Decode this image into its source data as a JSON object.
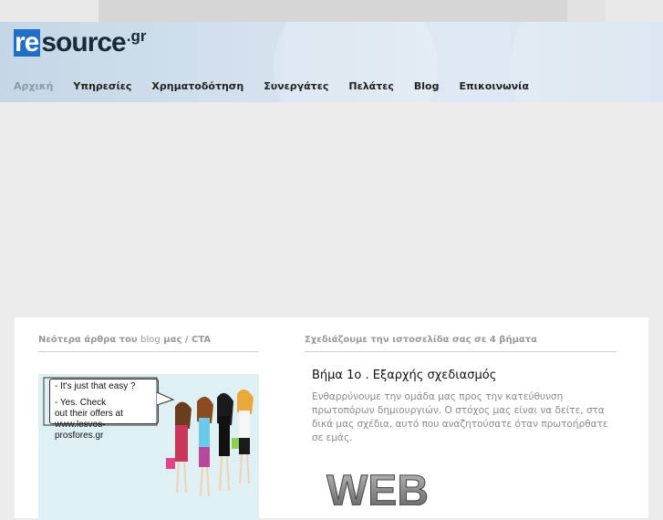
{
  "logo": {
    "prefix": "re",
    "rest": "source",
    "tld": ".gr"
  },
  "nav": {
    "items": [
      {
        "label": "Αρχική"
      },
      {
        "label": "Υπηρεσίες"
      },
      {
        "label": "Χρηματοδότηση"
      },
      {
        "label": "Συνεργάτες"
      },
      {
        "label": "Πελάτες"
      },
      {
        "label": "Blog"
      },
      {
        "label": "Επικοινωνία"
      }
    ]
  },
  "left_column": {
    "title_pre": "Νεότερα άρθρα του ",
    "title_blog": "blog",
    "title_post": " μας / CTA",
    "promo": {
      "line1": "- It's just that easy ?",
      "line2": "- Yes. Check",
      "line3": "out their offers at",
      "line4": "www.lesvos-prosfores.gr"
    }
  },
  "right_column": {
    "title": "Σχεδιάζουμε την ιστοσελίδα σας σε 4 βήματα",
    "step_title": "Βήμα 1ο . Εξαρχής σχεδιασμός",
    "step_text": "Ενθαρρύνουμε την ομάδα μας προς την κατεύθυνση πρωτοπόρων δημιουργιών. Ο στόχος μας είναι να δείτε, στα δικά μας σχέδια, αυτό που αναζητούσατε όταν πρωτοήρθατε σε εμάς.",
    "image_text": "WEB"
  },
  "colors": {
    "accent": "#1d6fc7",
    "header_bg": "#d6e3ef",
    "nav_active": "#8a9aa8"
  }
}
